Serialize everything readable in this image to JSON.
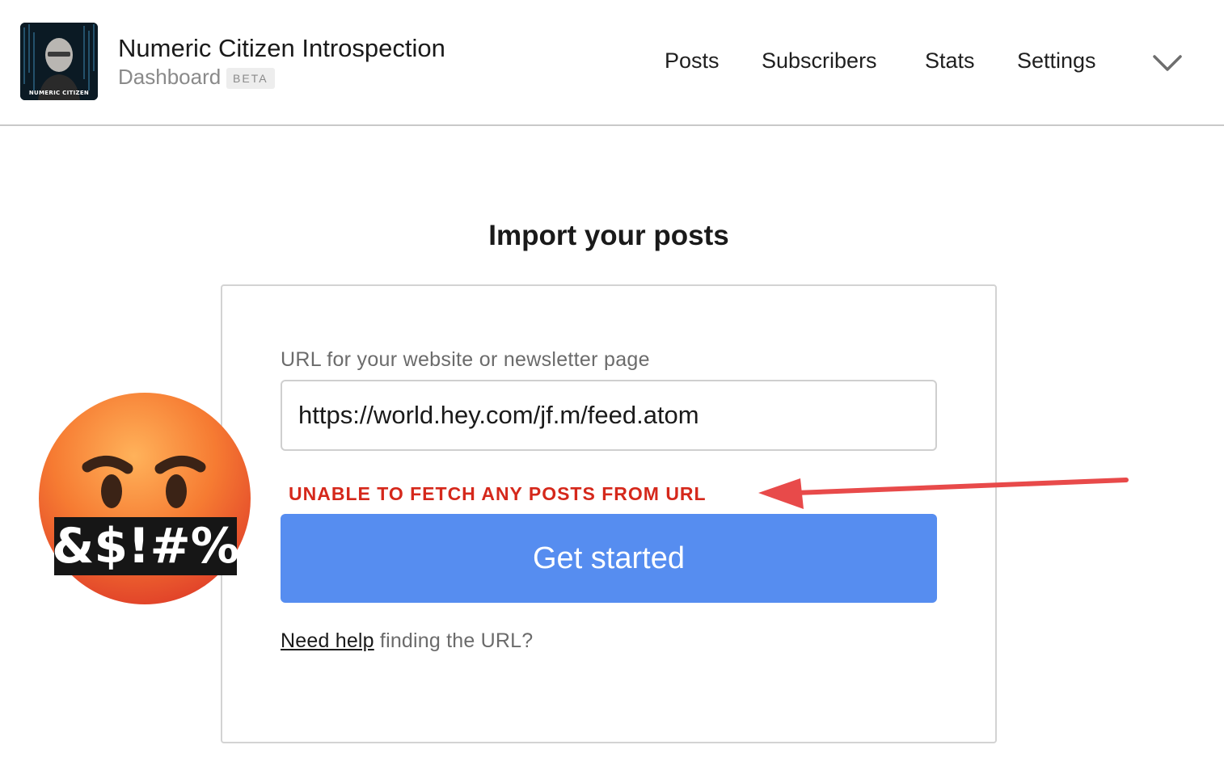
{
  "header": {
    "publication_name": "Numeric Citizen Introspection",
    "subtitle": "Dashboard",
    "badge": "BETA",
    "logo_caption": "NUMERIC CITIZEN",
    "nav": [
      {
        "label": "Posts"
      },
      {
        "label": "Subscribers"
      },
      {
        "label": "Stats"
      },
      {
        "label": "Settings"
      }
    ],
    "menu_icon": "chevron-down-icon"
  },
  "main": {
    "title": "Import your posts",
    "url_label": "URL for your website or newsletter page",
    "url_value": "https://world.hey.com/jf.m/feed.atom",
    "error": "UNABLE TO FETCH ANY POSTS FROM URL",
    "cta_label": "Get started",
    "help_link": "Need help",
    "help_rest": " finding the URL?"
  },
  "annotation": {
    "emoji_icon": "angry-face-with-symbols-icon",
    "emoji_text": "&$!#%",
    "arrow_icon": "red-arrow-icon"
  },
  "colors": {
    "accent_button": "#568df0",
    "error": "#d5281b",
    "arrow": "#e84a4a",
    "muted_text": "#6b6b6b"
  }
}
